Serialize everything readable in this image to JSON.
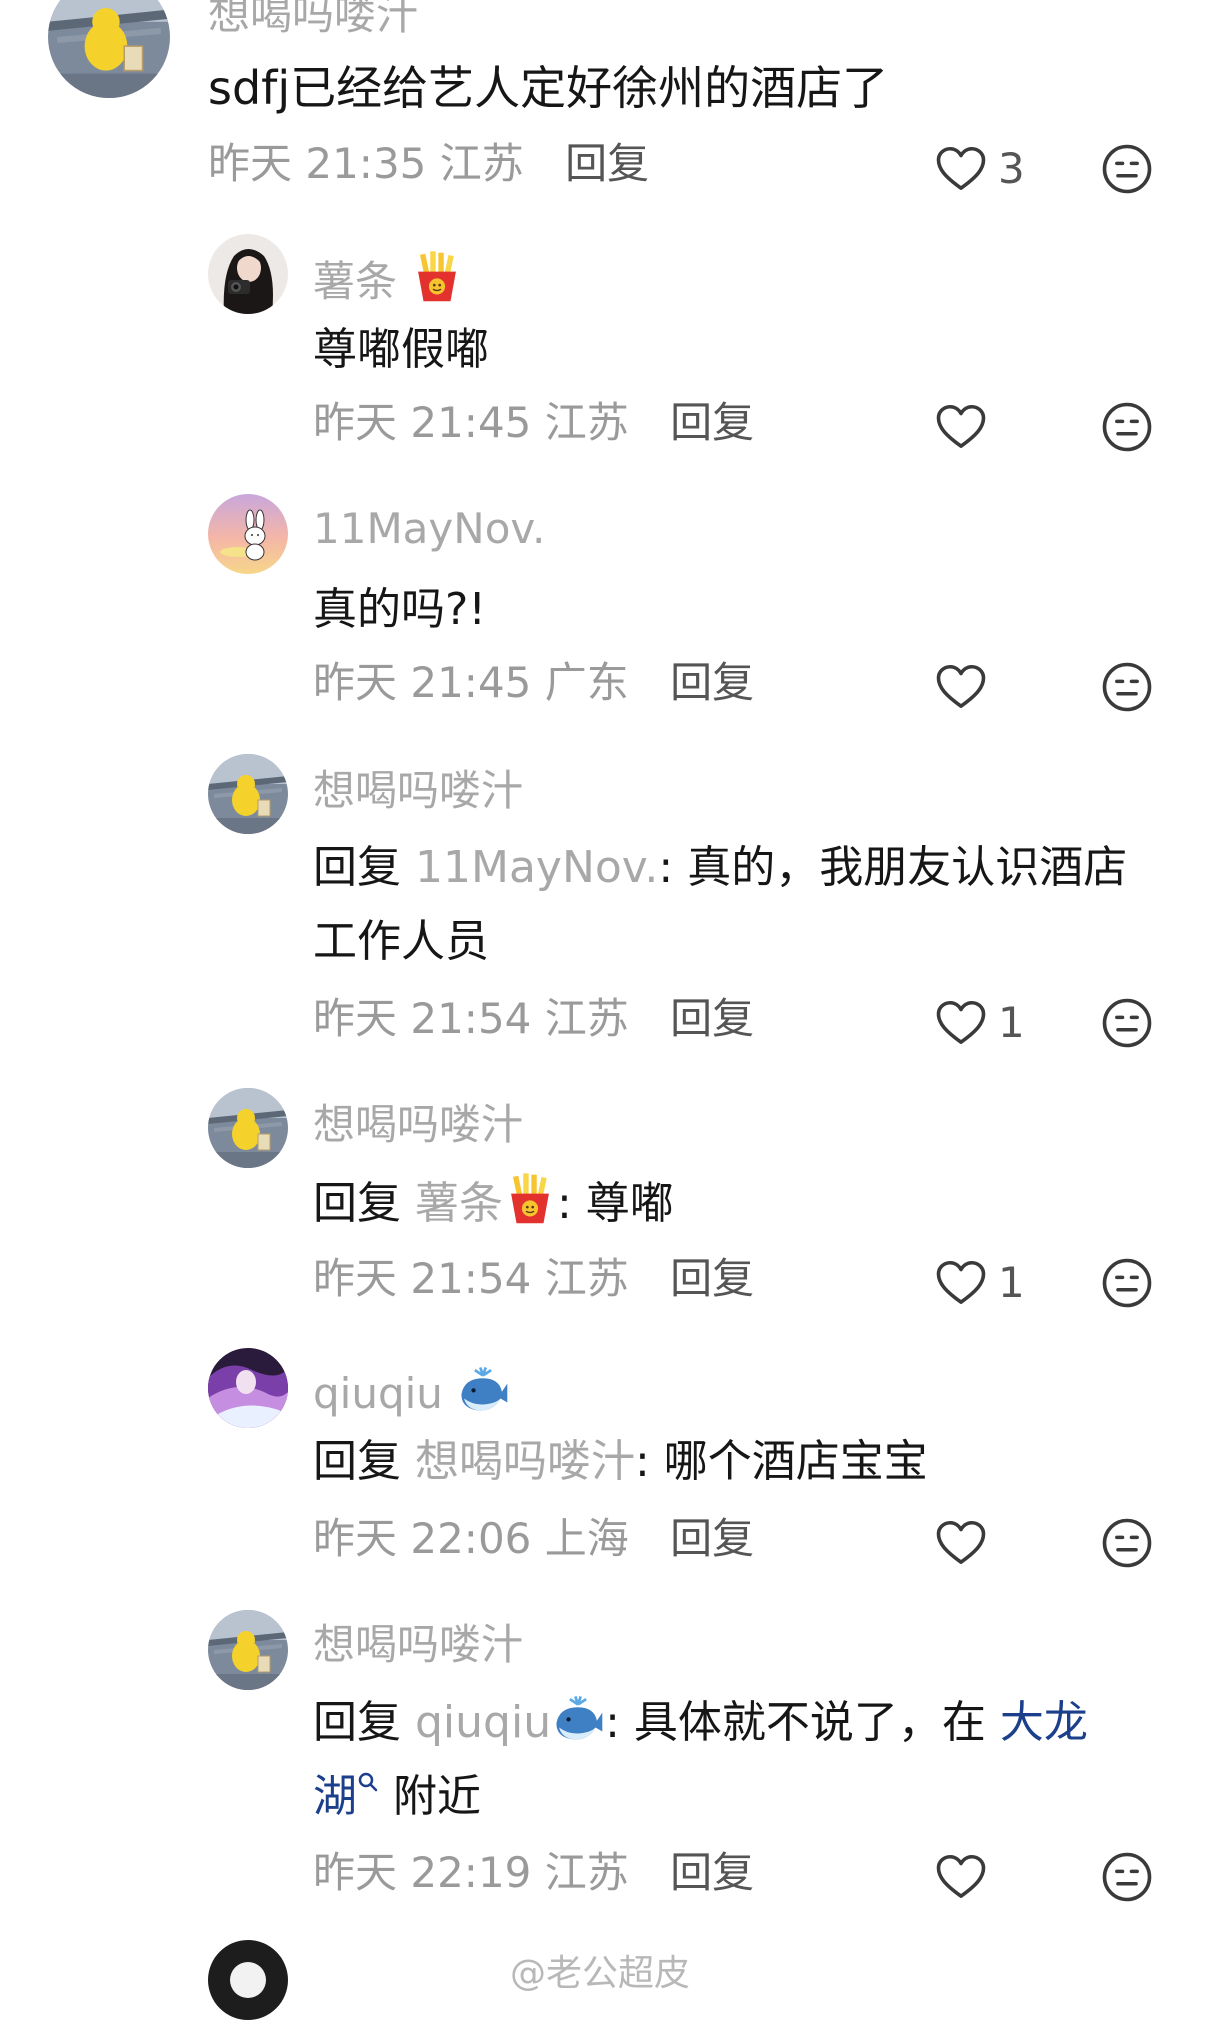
{
  "comments": [
    {
      "username": "想喝吗喽汁",
      "text": "sdfj已经给艺人定好徐州的酒店了",
      "time": "昨天 21:35",
      "location": "江苏",
      "reply_label": "回复",
      "likes": "3",
      "avatar": "duck-avatar"
    },
    {
      "username": "薯条",
      "username_emoji": "french-fries-emoji",
      "text": "尊嘟假嘟",
      "time": "昨天 21:45",
      "location": "江苏",
      "reply_label": "回复",
      "likes": "",
      "avatar": "girl-camera-avatar"
    },
    {
      "username": "11MayNov.",
      "text": "真的吗?!",
      "time": "昨天 21:45",
      "location": "广东",
      "reply_label": "回复",
      "likes": "",
      "avatar": "sunset-bunny-avatar"
    },
    {
      "username": "想喝吗喽汁",
      "reply_prefix": "回复",
      "reply_to": "11MayNov.",
      "text_line1": ": 真的，我朋友认识酒店",
      "text_line2": "工作人员",
      "time": "昨天 21:54",
      "location": "江苏",
      "reply_label": "回复",
      "likes": "1",
      "avatar": "duck-avatar"
    },
    {
      "username": "想喝吗喽汁",
      "reply_prefix": "回复",
      "reply_to": "薯条",
      "reply_to_emoji": "french-fries-emoji",
      "text": ": 尊嘟",
      "time": "昨天 21:54",
      "location": "江苏",
      "reply_label": "回复",
      "likes": "1",
      "avatar": "duck-avatar"
    },
    {
      "username": "qiuqiu",
      "username_emoji": "whale-emoji",
      "reply_prefix": "回复",
      "reply_to": "想喝吗喽汁",
      "text": ": 哪个酒店宝宝",
      "time": "昨天 22:06",
      "location": "上海",
      "reply_label": "回复",
      "likes": "",
      "avatar": "purple-hair-avatar"
    },
    {
      "username": "想喝吗喽汁",
      "reply_prefix": "回复",
      "reply_to": "qiuqiu",
      "reply_to_emoji": "whale-emoji",
      "text_line1": ": 具体就不说了，在 ",
      "link_line1": "大龙",
      "link_line2": "湖",
      "text_line2": " 附近",
      "time": "昨天 22:19",
      "location": "江苏",
      "reply_label": "回复",
      "likes": "",
      "avatar": "duck-avatar"
    }
  ],
  "watermark": "@老公超皮",
  "colors": {
    "text": "#161616",
    "muted": "#a8a8a8",
    "link": "#1c3f8c"
  },
  "icons": {
    "like": "heart-outline-icon",
    "react": "meh-face-icon",
    "search": "search-icon"
  }
}
